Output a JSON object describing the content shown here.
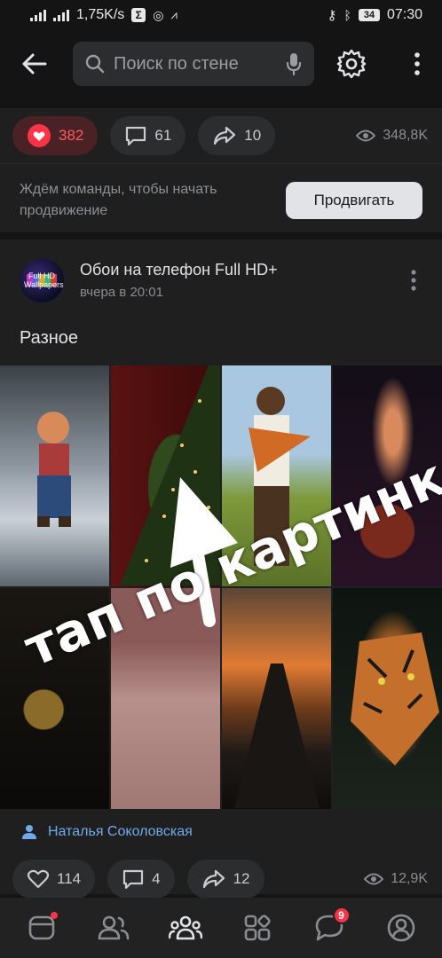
{
  "status_bar": {
    "network_speed": "1,75K/s",
    "battery": "34",
    "time": "07:30"
  },
  "header": {
    "search_placeholder": "Поиск по стене"
  },
  "top_post": {
    "likes": "382",
    "comments": "61",
    "shares": "10",
    "views": "348,8K",
    "promo_text": "Ждём команды, чтобы начать продвижение",
    "promo_button": "Продвигать"
  },
  "post": {
    "author": "Обои на телефон Full HD+",
    "avatar_text": "Full HD Wallpapers",
    "time": "вчера в 20:01",
    "text": "Разное",
    "overlay_text": "тап по картинке",
    "poster_name": "Наталья Соколовская",
    "likes": "114",
    "comments": "4",
    "shares": "12",
    "views": "12,9K"
  },
  "tabbar": {
    "messages_badge": "9"
  },
  "colors": {
    "background": "#141414",
    "card": "#1f1f20",
    "accent_link": "#71aaeb",
    "like_red": "#ff3347"
  },
  "icons": [
    "back-arrow-icon",
    "search-icon",
    "mic-icon",
    "gear-icon",
    "more-vertical-icon",
    "heart-icon",
    "comment-icon",
    "share-icon",
    "eye-icon",
    "user-icon",
    "news-icon",
    "friends-icon",
    "communities-icon",
    "services-icon",
    "messages-icon",
    "profile-icon"
  ]
}
